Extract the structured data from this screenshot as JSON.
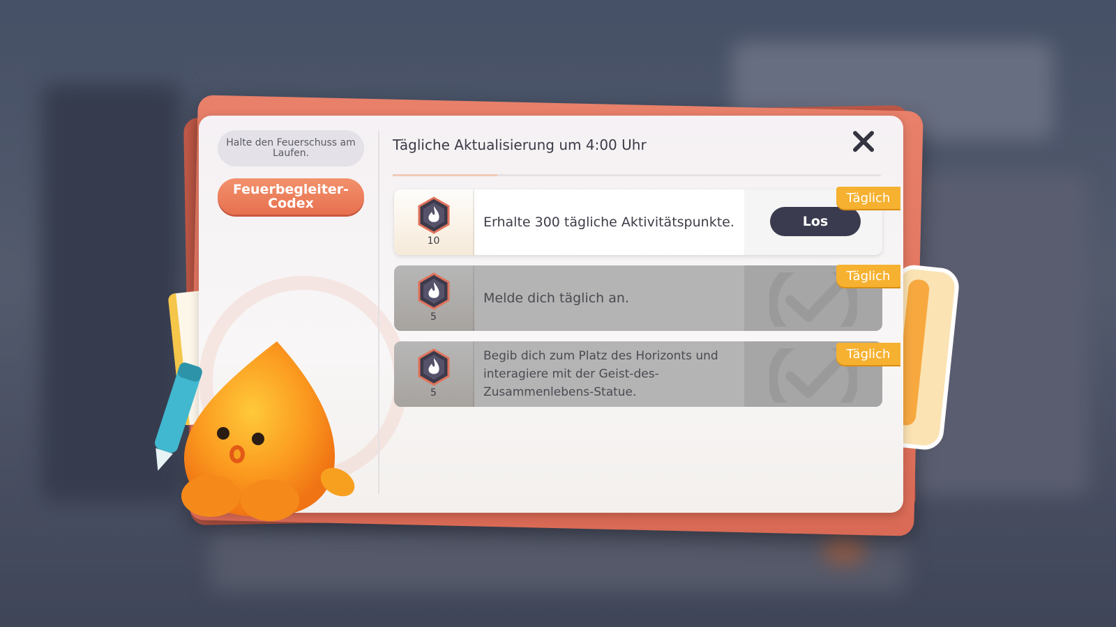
{
  "colors": {
    "accent_orange": "#e7704f",
    "tag_yellow": "#f6b130",
    "button_dark": "#3a3b4f",
    "done_gray": "#b4b4b4"
  },
  "sidebar": {
    "hint": "Halte den Feuerschuss am Laufen.",
    "codex_button": "Feuerbegleiter-Codex"
  },
  "header": {
    "title": "Tägliche Aktualisierung um 4:00 Uhr",
    "close_icon": "close-icon"
  },
  "tasks": [
    {
      "points": "10",
      "description": "Erhalte 300 tägliche Aktivitätspunkte.",
      "tag": "Täglich",
      "state": "active",
      "action_label": "Los"
    },
    {
      "points": "5",
      "description": "Melde dich täglich an.",
      "tag": "Täglich",
      "state": "completed"
    },
    {
      "points": "5",
      "description": "Begib dich zum Platz des Horizonts und interagiere mit der Geist-des-Zusammenlebens-Statue.",
      "tag": "Täglich",
      "state": "completed"
    }
  ],
  "icons": {
    "task_icon": "flame-hexagon-icon",
    "done_icon": "checkmark-icon"
  }
}
